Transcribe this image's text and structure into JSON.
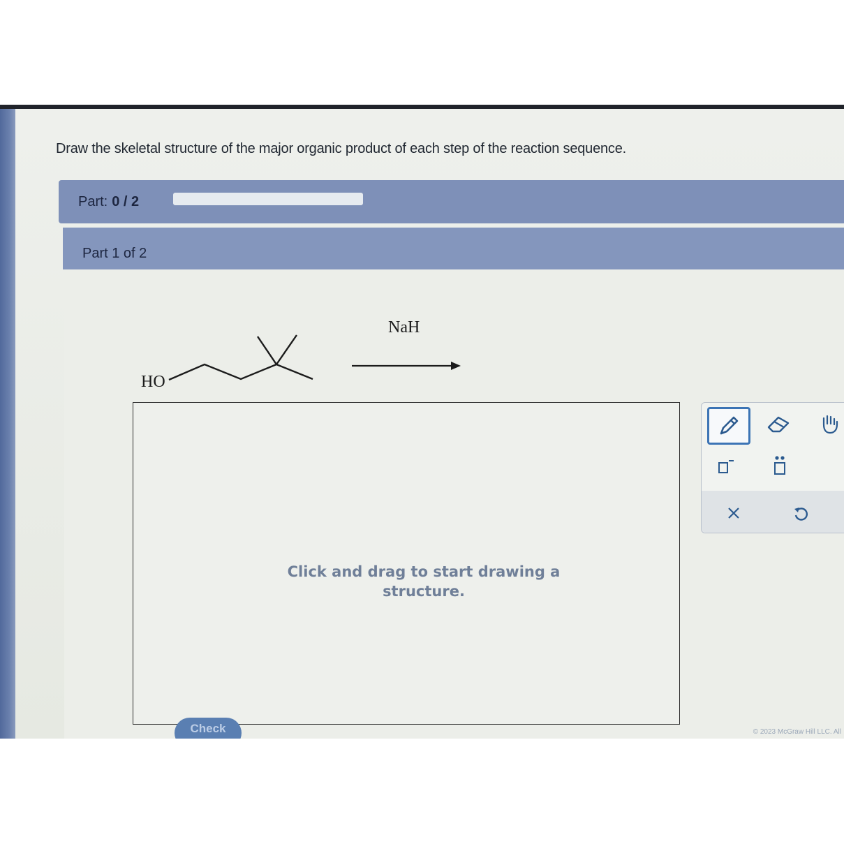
{
  "instruction": "Draw the skeletal structure of the major organic product of each step of the reaction sequence.",
  "progress": {
    "label": "Part:",
    "count": "0 / 2",
    "fraction": 0
  },
  "part_header": "Part 1 of 2",
  "reaction": {
    "reactant_group": "HO",
    "reagent": "NaH"
  },
  "canvas": {
    "hint": "Click and drag to start drawing a structure."
  },
  "toolbox": {
    "tools": [
      "pencil-icon",
      "eraser-icon",
      "hand-icon",
      "charge-minus-icon",
      "lone-pair-icon",
      "clear-icon",
      "undo-icon"
    ]
  },
  "check_button": "Check",
  "footer": {
    "copyright": "© 2023 McGraw Hill LLC. All"
  },
  "colors": {
    "accent": "#3c74b5",
    "part_bar": "#7e90b8",
    "hint_text": "#6f7f98"
  }
}
